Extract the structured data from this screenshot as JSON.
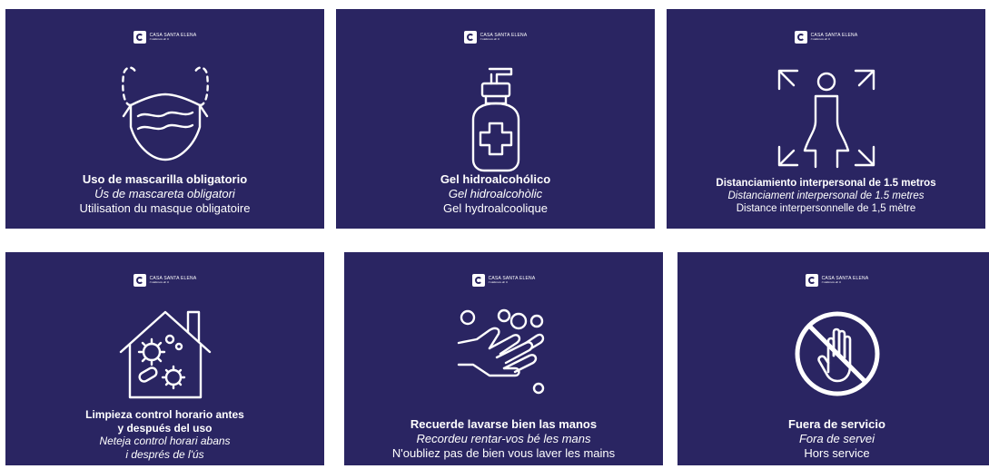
{
  "brand": {
    "name": "CASA SANTA ELENA",
    "tagline": "Cuidamos de ti"
  },
  "colors": {
    "card_background": "#2a2562",
    "foreground": "#ffffff"
  },
  "cards": [
    {
      "icon": "face-mask-icon",
      "es": "Uso de mascarilla obligatorio",
      "ca": "Ús de mascareta obligatori",
      "fr": "Utilisation du masque obligatoire"
    },
    {
      "icon": "hand-sanitizer-icon",
      "es": "Gel hidroalcohólico",
      "ca": "Gel hidroalcohòlic",
      "fr": "Gel hydroalcoolique"
    },
    {
      "icon": "social-distancing-icon",
      "es": "Distanciamiento interpersonal de 1.5 metros",
      "ca": "Distanciament interpersonal de 1.5 metres",
      "fr": "Distance interpersonnelle de 1,5 mètre"
    },
    {
      "icon": "house-virus-icon",
      "es_line1": "Limpieza control horario antes",
      "es_line2": "y después del uso",
      "ca_line1": "Neteja control horari abans",
      "ca_line2": "i després de l'ús"
    },
    {
      "icon": "hand-washing-icon",
      "es": "Recuerde lavarse bien las manos",
      "ca": "Recordeu rentar-vos bé les mans",
      "fr": "N'oubliez pas de bien vous laver les mains"
    },
    {
      "icon": "no-touch-icon",
      "es": "Fuera de servicio",
      "ca": "Fora de servei",
      "fr": "Hors service"
    }
  ]
}
